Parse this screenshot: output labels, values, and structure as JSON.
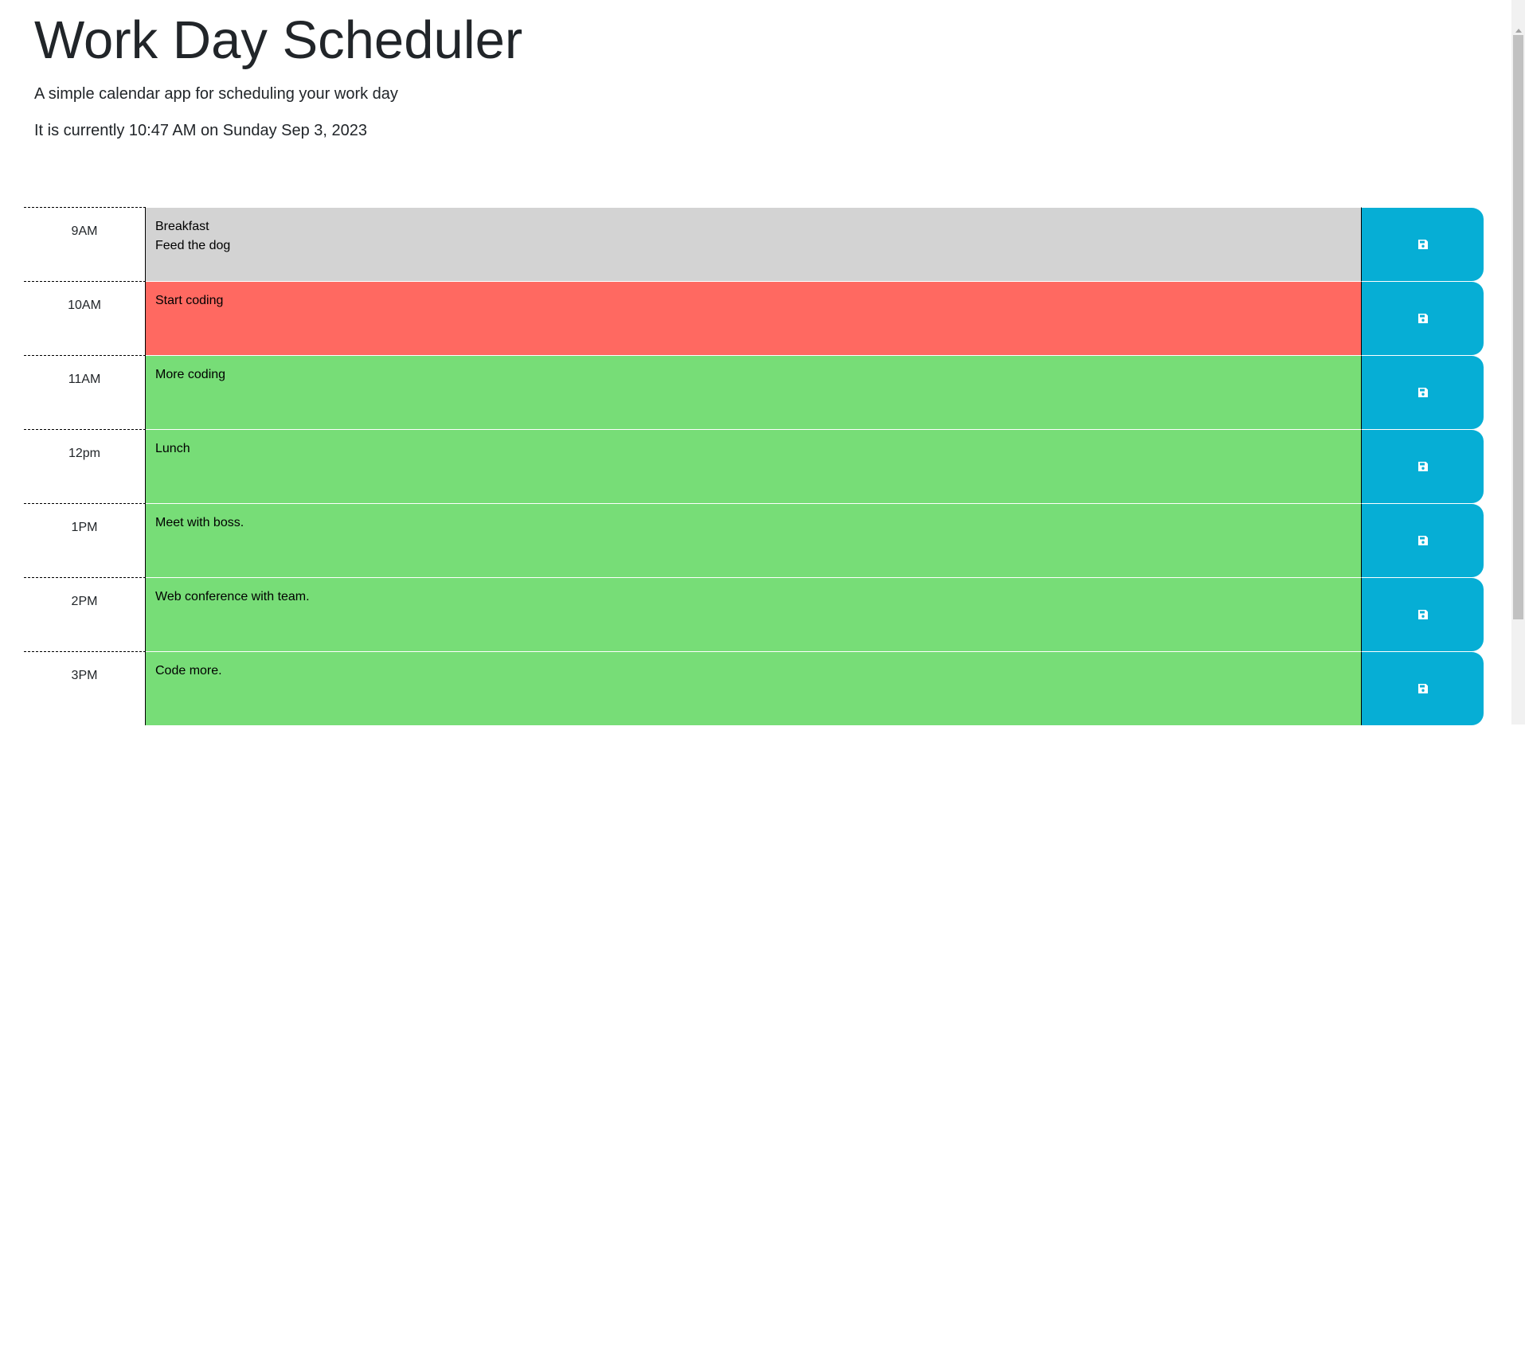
{
  "header": {
    "title": "Work Day Scheduler",
    "lead": "A simple calendar app for scheduling your work day",
    "current_time": "It is currently 10:47 AM on Sunday Sep 3, 2023"
  },
  "schedule": [
    {
      "hour": "9AM",
      "text": " Breakfast\nFeed the dog",
      "status": "past"
    },
    {
      "hour": "10AM",
      "text": " Start coding",
      "status": "present"
    },
    {
      "hour": "11AM",
      "text": "More coding",
      "status": "future"
    },
    {
      "hour": "12pm",
      "text": " Lunch",
      "status": "future"
    },
    {
      "hour": "1PM",
      "text": " Meet with boss.",
      "status": "future"
    },
    {
      "hour": "2PM",
      "text": "Web conference with team.",
      "status": "future"
    },
    {
      "hour": "3PM",
      "text": " Code more.",
      "status": "future"
    }
  ],
  "icons": {
    "save": "floppy-disk-icon"
  },
  "colors": {
    "past": "#d3d3d3",
    "present": "#ff6961",
    "future": "#77dd77",
    "save_button": "#06aed5"
  }
}
